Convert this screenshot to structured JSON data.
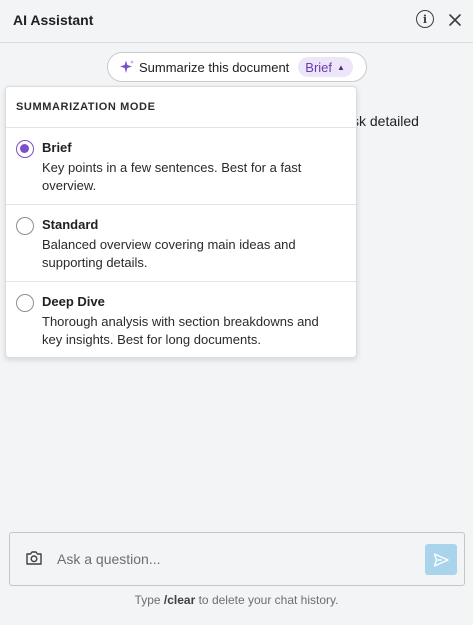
{
  "header": {
    "title": "AI Assistant",
    "info_icon": "info-icon",
    "close_icon": "close-icon"
  },
  "action_pill": {
    "icon": "sparkle-icon",
    "label": "Summarize this document",
    "mode": "Brief",
    "caret_icon": "caret-up-icon"
  },
  "background_text": "sk detailed",
  "dropdown": {
    "heading": "SUMMARIZATION MODE",
    "options": [
      {
        "title": "Brief",
        "description": "Key points in a few sentences. Best for a fast overview.",
        "selected": true
      },
      {
        "title": "Standard",
        "description": "Balanced overview covering main ideas and supporting details.",
        "selected": false
      },
      {
        "title": "Deep Dive",
        "description": "Thorough analysis with section breakdowns and key insights. Best for long documents.",
        "selected": false
      }
    ]
  },
  "composer": {
    "camera_icon": "camera-icon",
    "placeholder": "Ask a question...",
    "value": "",
    "send_icon": "send-icon"
  },
  "footer": {
    "hint_prefix": "Type ",
    "hint_command": "/clear",
    "hint_suffix": " to delete your chat history."
  },
  "colors": {
    "accent": "#7b4fc9",
    "badge_bg": "#ede5f8",
    "send_button": "#a9d4ec",
    "panel_bg": "#f3f4f6"
  }
}
